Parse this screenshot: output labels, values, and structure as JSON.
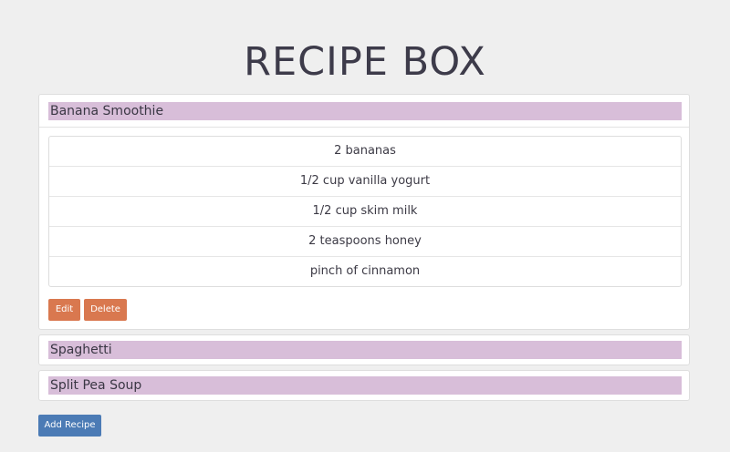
{
  "app": {
    "title": "RECIPE BOX"
  },
  "recipes": [
    {
      "name": "Banana Smoothie",
      "expanded": true,
      "ingredients": [
        "2 bananas",
        "1/2 cup vanilla yogurt",
        "1/2 cup skim milk",
        "2 teaspoons honey",
        "pinch of cinnamon"
      ],
      "edit_label": "Edit",
      "delete_label": "Delete"
    },
    {
      "name": "Spaghetti",
      "expanded": false
    },
    {
      "name": "Split Pea Soup",
      "expanded": false
    }
  ],
  "actions": {
    "add_recipe_label": "Add Recipe"
  },
  "colors": {
    "background": "#efefef",
    "recipe_heading": "#d8bed9",
    "edit_delete_button": "#d9784f",
    "add_button": "#4b7bb5"
  }
}
